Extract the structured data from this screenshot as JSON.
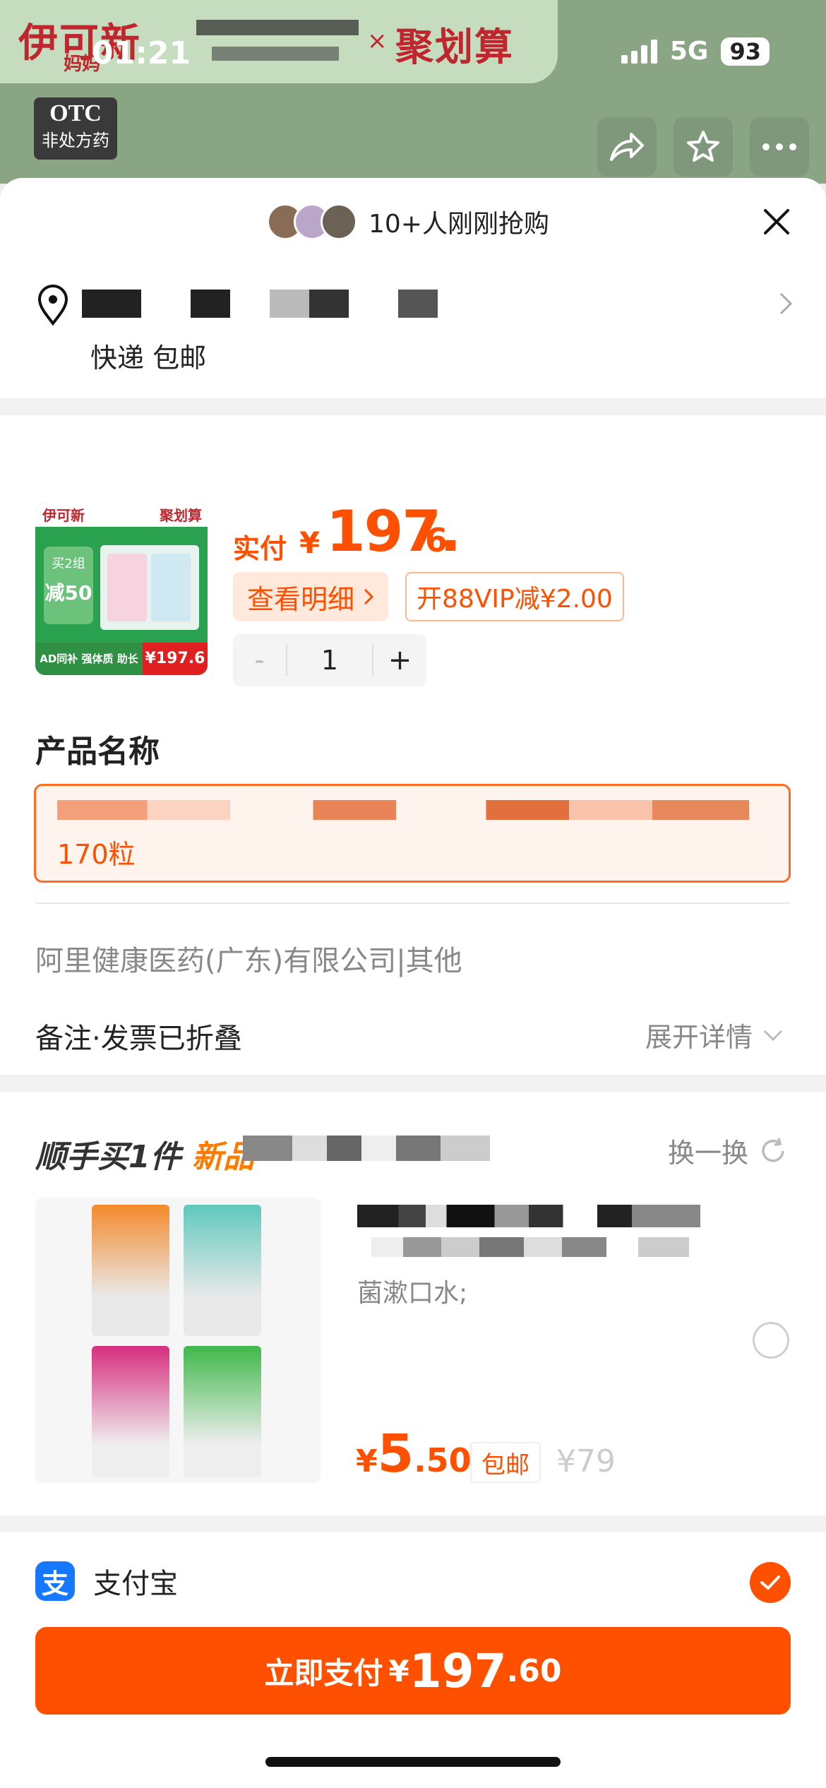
{
  "status_bar": {
    "time": "01:21",
    "network": "5G",
    "battery": "93"
  },
  "background": {
    "brand_logo": "伊可新",
    "brand_logo_sub": "妈妈",
    "times_sign": "×",
    "campaign": "聚划算",
    "otc_label": "OTC",
    "otc_sub": "非处方药"
  },
  "sheet": {
    "header_title": "10+人刚刚抢购",
    "shipping": "快递 包邮",
    "product": {
      "img_badge_top": "伊可新",
      "img_badge_campaign": "聚划算",
      "img_promo_title": "买2组",
      "img_promo_big": "减50",
      "img_bottom_text": "AD同补 强体质 助长高",
      "img_price": "¥197.6",
      "price_label": "实付",
      "price_yen": "¥",
      "price_int": "197.",
      "price_dec": "6",
      "detail_button": "查看明细",
      "vip_tag": "开88VIP减¥2.00",
      "quantity": "1",
      "minus": "-",
      "plus": "+"
    },
    "section_title": "产品名称",
    "selected_option_text": "170粒",
    "seller": "阿里健康医药(广东)有限公司|其他",
    "remark": "备注·发票已折叠",
    "expand": "展开详情",
    "recommend": {
      "title_prefix": "顺手买1件",
      "title_new": "新品",
      "swap": "换一换",
      "desc": "菌漱口水;",
      "price_yen": "¥",
      "price_int": "5",
      "price_dec": ".50",
      "ship_tag": "包邮",
      "orig_price": "¥79"
    },
    "payment": {
      "method": "支付宝",
      "icon_char": "支"
    },
    "pay_button": {
      "label": "立即支付",
      "yen": "¥",
      "int": "197",
      "dec": ".60"
    }
  },
  "colors": {
    "accent": "#ff5000",
    "alipay": "#1677ff"
  }
}
